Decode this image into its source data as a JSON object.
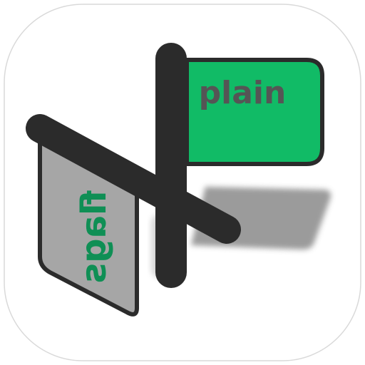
{
  "icon": {
    "name": "plain-flags-app-icon",
    "flags": {
      "front_label": "plain",
      "back_label": "flags"
    },
    "colors": {
      "background": "#ffffff",
      "tile_border": "#d9d9d9",
      "pole": "#2b2b2b",
      "green_flag": "#11bb66",
      "grey_flag": "#a6a6a6",
      "front_text": "#555555",
      "back_text": "#0f8f55",
      "shadow": "#8a8a8a"
    }
  }
}
